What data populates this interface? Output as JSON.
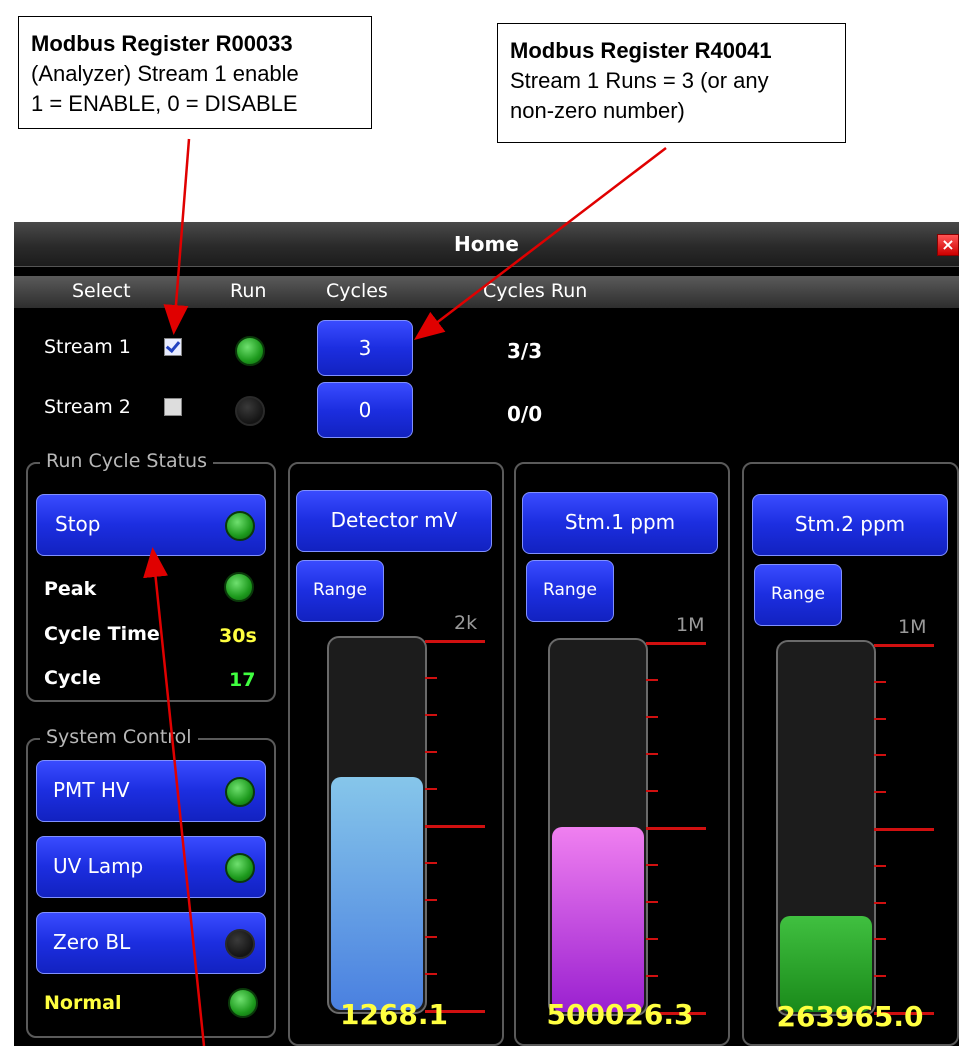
{
  "callouts": [
    {
      "title": "Modbus Register R00033",
      "line1": "(Analyzer) Stream 1 enable",
      "line2": "1 = ENABLE, 0 = DISABLE"
    },
    {
      "title": "Modbus Register R40041",
      "line1": "Stream 1 Runs = 3 (or any",
      "line2": "non-zero number)"
    }
  ],
  "window": {
    "title": "Home",
    "close_label": "×"
  },
  "columns": {
    "select": "Select",
    "run": "Run",
    "cycles": "Cycles",
    "cycles_run": "Cycles Run"
  },
  "streams": [
    {
      "label": "Stream 1",
      "checked": true,
      "run_led": "green",
      "cycles": "3",
      "cycles_run": "3/3"
    },
    {
      "label": "Stream 2",
      "checked": false,
      "run_led": "off",
      "cycles": "0",
      "cycles_run": "0/0"
    }
  ],
  "run_cycle_status": {
    "title": "Run Cycle Status",
    "stop_label": "Stop",
    "peak_label": "Peak",
    "cycle_time_label": "Cycle Time",
    "cycle_time_value": "30s",
    "cycle_label": "Cycle",
    "cycle_value": "17"
  },
  "system_control": {
    "title": "System Control",
    "pmt_hv_label": "PMT HV",
    "uv_lamp_label": "UV Lamp",
    "zero_bl_label": "Zero BL",
    "status_label": "Normal"
  },
  "gauges": [
    {
      "title": "Detector mV",
      "range_label": "Range",
      "scale_max": "2k",
      "value": "1268.1",
      "fill_fraction": 0.63,
      "color_top": "#86c6ea",
      "color_bottom": "#4a80e0"
    },
    {
      "title": "Stm.1 ppm",
      "range_label": "Range",
      "scale_max": "1M",
      "value": "500026.3",
      "fill_fraction": 0.5,
      "color_top": "#f080f0",
      "color_bottom": "#9a20d0"
    },
    {
      "title": "Stm.2 ppm",
      "range_label": "Range",
      "scale_max": "1M",
      "value": "263965.0",
      "fill_fraction": 0.26,
      "color_top": "#40c040",
      "color_bottom": "#1a8a1a"
    }
  ],
  "colors": {
    "accent_blue": "#1c2ee0",
    "value_yellow": "#ffff40",
    "value_green": "#40ff40",
    "arrow_red": "#e00000"
  }
}
